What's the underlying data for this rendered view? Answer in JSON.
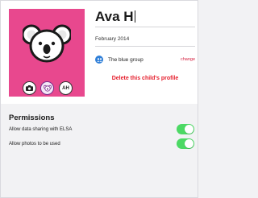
{
  "profile": {
    "name_value": "Ava H",
    "birth_value": "February 2014",
    "initials": "AH",
    "avatar_icon": "koala-icon",
    "avatar_background": "#e8488e",
    "group": {
      "icon": "group-icon",
      "name": "The blue group",
      "change_label": "change"
    },
    "delete_label": "Delete this child's profile"
  },
  "permissions": {
    "title": "Permissions",
    "items": [
      {
        "label": "Allow data sharing with ELSA",
        "enabled": true
      },
      {
        "label": "Allow photos to be used",
        "enabled": true
      }
    ],
    "toggle_on_color": "#4cd964"
  }
}
